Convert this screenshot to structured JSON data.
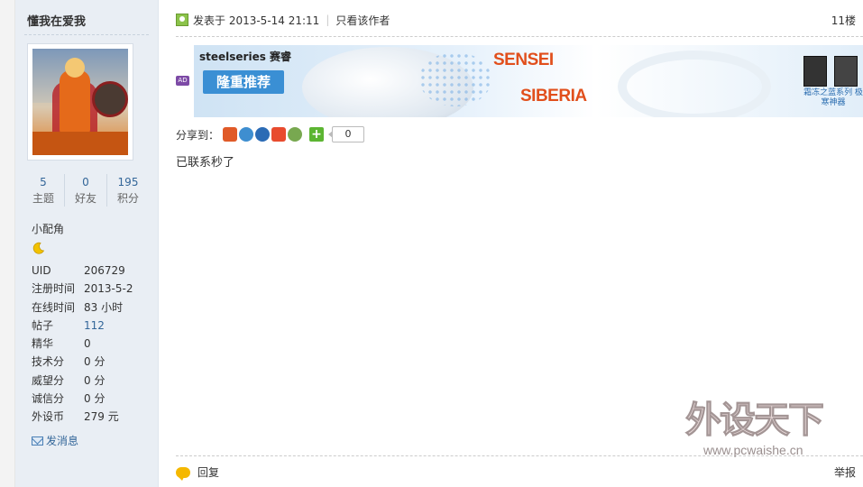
{
  "sidebar": {
    "username": "懂我在爱我",
    "stats": [
      {
        "value": "5",
        "label": "主题"
      },
      {
        "value": "0",
        "label": "好友"
      },
      {
        "value": "195",
        "label": "积分"
      }
    ],
    "rank": "小配角",
    "info": [
      {
        "key": "UID",
        "value": "206729"
      },
      {
        "key": "注册时间",
        "value": "2013-5-2"
      },
      {
        "key": "在线时间",
        "value": "83 小时"
      },
      {
        "key": "帖子",
        "value": "112"
      },
      {
        "key": "精华",
        "value": "0"
      },
      {
        "key": "技术分",
        "value": "0 分"
      },
      {
        "key": "威望分",
        "value": "0 分"
      },
      {
        "key": "诚信分",
        "value": "0 分"
      },
      {
        "key": "外设币",
        "value": "279 元"
      }
    ],
    "message_link": "发消息"
  },
  "post": {
    "time": "发表于 2013-5-14 21:11",
    "separator": "|",
    "author_only": "只看该作者",
    "floor": "11楼",
    "ad_tag": "AD",
    "banner": {
      "brand": "steelseries 赛睿",
      "promo": "隆重推荐",
      "product1": "SENSEI",
      "product2": "SIBERIA",
      "caption": "霜冻之蓝系列 极寒神器"
    },
    "share_label": "分享到：",
    "share_count": "0",
    "content": "已联系秒了",
    "reply": "回复",
    "report": "举报"
  },
  "watermark": {
    "title": "外设天下",
    "url": "www.pcwaishe.cn"
  }
}
